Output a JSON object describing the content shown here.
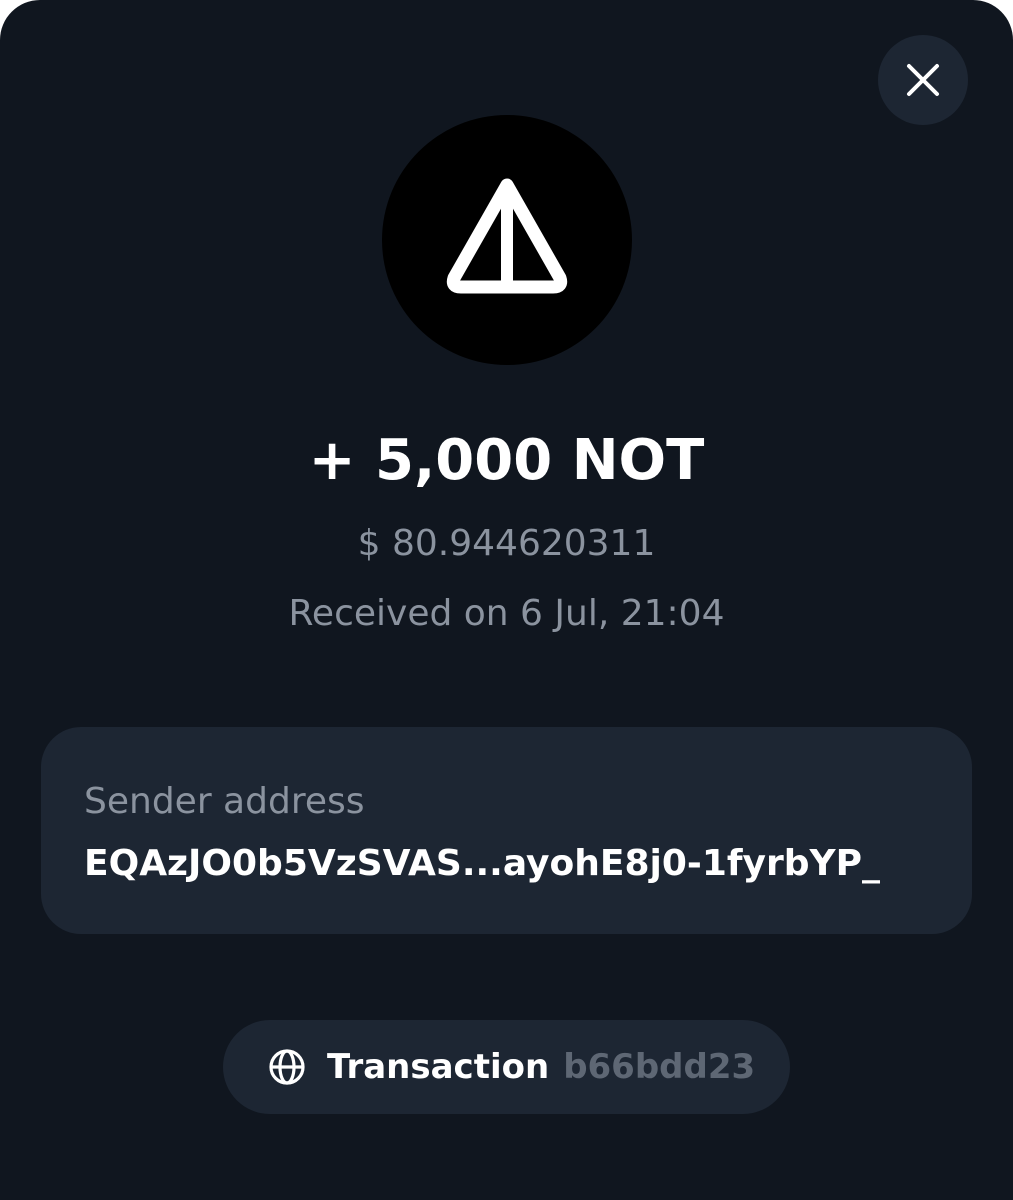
{
  "header": {
    "close_icon": "close-icon"
  },
  "token": {
    "logo_icon": "not-token-icon",
    "logo_bg": "#000000"
  },
  "transfer": {
    "amount": "+ 5,000 NOT",
    "fiat_value": "$ 80.944620311",
    "status_date": "Received on 6 Jul, 21:04"
  },
  "sender": {
    "label": "Sender address",
    "address": "EQAzJO0b5VzSVAS...ayohE8j0-1fyrbYP_"
  },
  "transaction": {
    "icon": "globe-icon",
    "label": "Transaction",
    "hash": "b66bdd23"
  },
  "colors": {
    "background": "#10161f",
    "card": "#1d2633",
    "primary_text": "#ffffff",
    "secondary_text": "#8b939f",
    "muted_text": "#5e6774"
  }
}
